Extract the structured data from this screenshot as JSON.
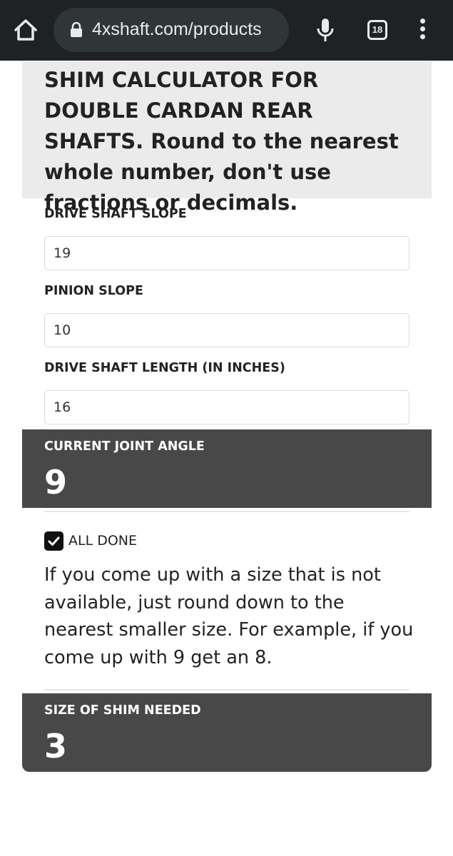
{
  "browser": {
    "url": "4xshaft.com/products",
    "tab_count": "18",
    "icons": {
      "home": "home-icon",
      "lock": "lock-icon",
      "mic": "microphone-icon",
      "tabs": "tab-switcher-icon",
      "menu": "more-vert-icon"
    }
  },
  "calculator": {
    "heading": "SHIM CALCULATOR FOR DOUBLE CARDAN REAR SHAFTS. Round to the nearest whole number, don't use fractions or decimals.",
    "fields": [
      {
        "label": "DRIVE SHAFT SLOPE",
        "value": "19"
      },
      {
        "label": "PINION SLOPE",
        "value": "10"
      },
      {
        "label": "DRIVE SHAFT LENGTH (IN INCHES)",
        "value": "16"
      }
    ],
    "joint_angle": {
      "label": "CURRENT JOINT ANGLE",
      "value": "9"
    },
    "all_done": {
      "label": "ALL DONE",
      "checked": true
    },
    "note": "If you come up with a size that is not available, just round down to the nearest smaller size. For example, if you come up with 9 get an 8.",
    "shim_size": {
      "label": "SIZE OF SHIM NEEDED",
      "value": "3"
    }
  },
  "colors": {
    "browser_bar": "#1f2223",
    "url_pill": "#303637",
    "heading_bg": "#ebebeb",
    "result_bg": "#484848",
    "text": "#222222"
  }
}
